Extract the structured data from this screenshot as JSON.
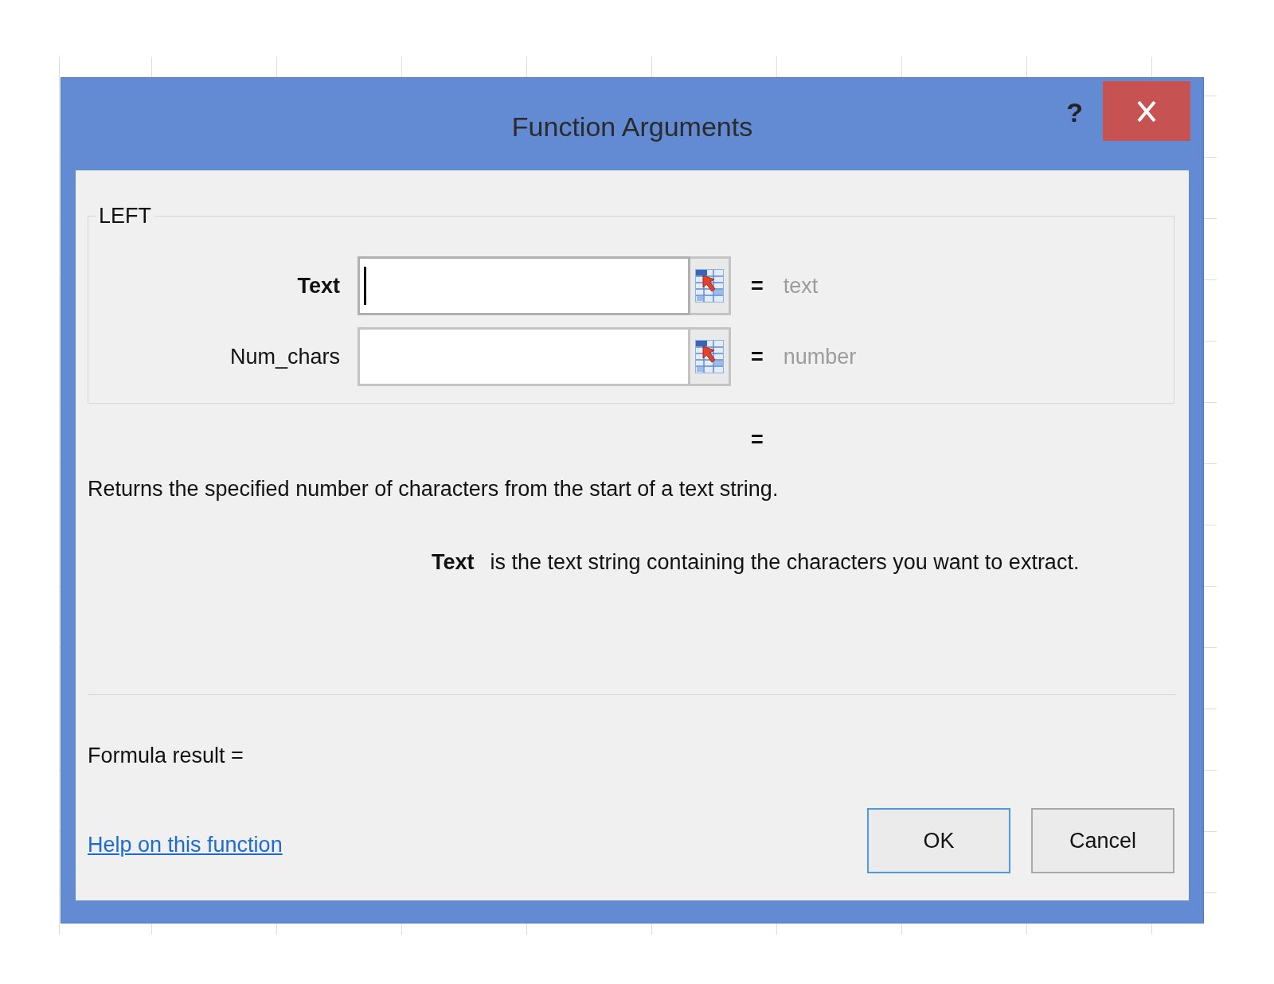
{
  "window": {
    "title": "Function Arguments",
    "help_button": "?"
  },
  "function": {
    "name": "LEFT",
    "arguments": [
      {
        "name": "Text",
        "required": true,
        "focused": true,
        "equals": "=",
        "hint": "text"
      },
      {
        "name": "Num_chars",
        "required": false,
        "focused": false,
        "equals": "=",
        "hint": "number"
      }
    ]
  },
  "result_preview": "=",
  "description": "Returns the specified number of characters from the start of a text string.",
  "argument_help": {
    "name": "Text",
    "text": "is the text string containing the characters you want to extract."
  },
  "formula_result": "Formula result =",
  "help_link": "Help on this function",
  "buttons": [
    {
      "label": "OK",
      "default": true
    },
    {
      "label": "Cancel",
      "default": false
    }
  ]
}
